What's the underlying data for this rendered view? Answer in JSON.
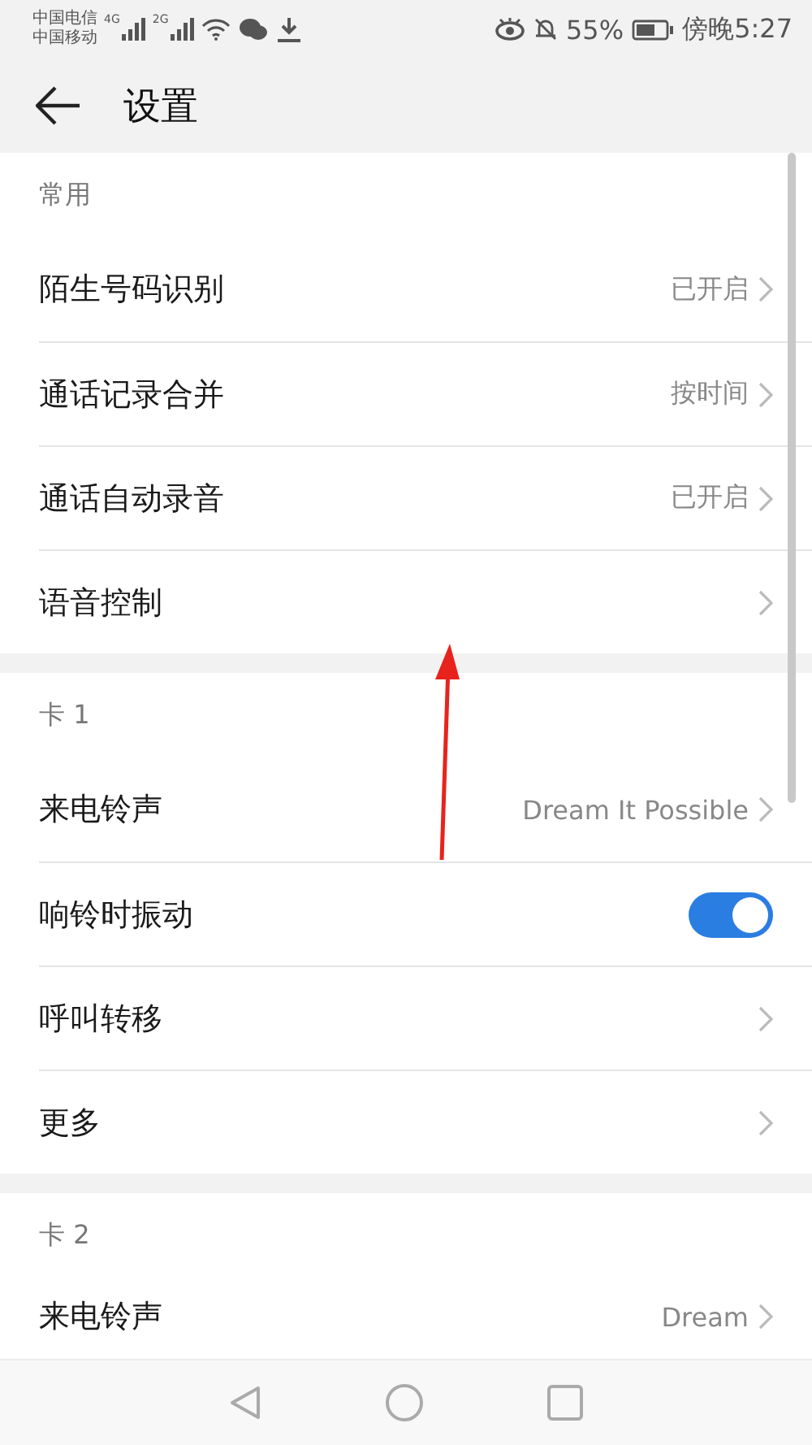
{
  "status_bar": {
    "carriers": [
      "中国电信",
      "中国移动"
    ],
    "network_labels": [
      "4G",
      "2G"
    ],
    "battery": "55%",
    "time": "傍晚5:27"
  },
  "header": {
    "title": "设置"
  },
  "sections": [
    {
      "title": "常用",
      "items": [
        {
          "kind": "link",
          "label": "陌生号码识别",
          "value": "已开启"
        },
        {
          "kind": "link",
          "label": "通话记录合并",
          "value": "按时间"
        },
        {
          "kind": "link",
          "label": "通话自动录音",
          "value": "已开启"
        },
        {
          "kind": "link",
          "label": "语音控制"
        }
      ]
    },
    {
      "title": "卡 1",
      "items": [
        {
          "kind": "link",
          "label": "来电铃声",
          "value": "Dream It Possible"
        },
        {
          "kind": "toggle",
          "label": "响铃时振动",
          "on": true
        },
        {
          "kind": "link",
          "label": "呼叫转移"
        },
        {
          "kind": "link",
          "label": "更多"
        }
      ]
    },
    {
      "title": "卡 2",
      "items": [
        {
          "kind": "link",
          "label": "来电铃声",
          "value": "Dream"
        }
      ]
    }
  ]
}
